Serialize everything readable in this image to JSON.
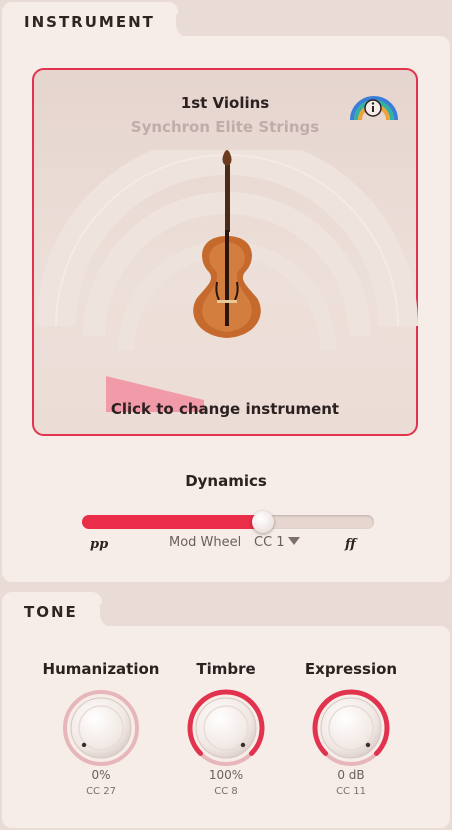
{
  "instrument_section": {
    "tab_label": "INSTRUMENT",
    "name": "1st Violins",
    "library": "Synchron Elite Strings",
    "hint": "Click to change instrument"
  },
  "dynamics": {
    "title": "Dynamics",
    "min_label": "pp",
    "max_label": "ff",
    "controller_label": "Mod Wheel",
    "cc_value": "CC 1",
    "level": 0.63
  },
  "tone_section": {
    "tab_label": "TONE",
    "knobs": [
      {
        "title": "Humanization",
        "value": "0%",
        "cc": "CC 27",
        "level": 0.0
      },
      {
        "title": "Timbre",
        "value": "100%",
        "cc": "CC 8",
        "level": 1.0
      },
      {
        "title": "Expression",
        "value": "0 dB",
        "cc": "CC 11",
        "level": 1.0
      }
    ]
  },
  "colors": {
    "accent": "#e2334e",
    "panel": "#f7ede8",
    "background": "#e9dcd6"
  }
}
